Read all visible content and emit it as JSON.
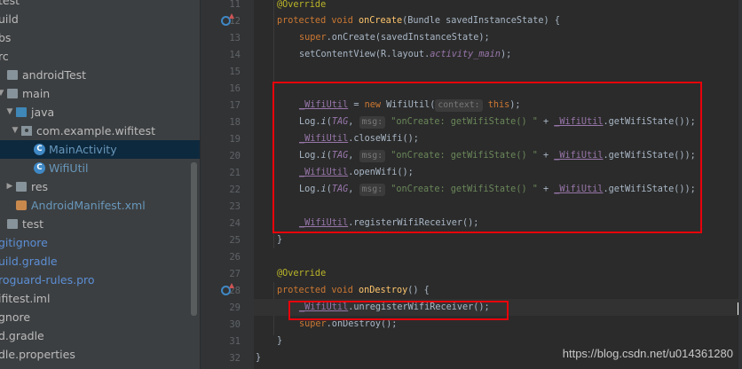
{
  "tree": {
    "items": [
      {
        "label": "test",
        "indent": 0,
        "icon": "none"
      },
      {
        "label": "uild",
        "indent": 0,
        "icon": "none"
      },
      {
        "label": "bs",
        "indent": 0,
        "icon": "none"
      },
      {
        "label": "rc",
        "indent": 0,
        "icon": "none"
      },
      {
        "label": "androidTest",
        "indent": 0,
        "icon": "folder"
      },
      {
        "label": "main",
        "indent": 0,
        "icon": "folder"
      },
      {
        "label": "java",
        "indent": 1,
        "icon": "folder-blue"
      },
      {
        "label": "com.example.wifitest",
        "indent": 2,
        "icon": "package"
      },
      {
        "label": "MainActivity",
        "indent": 3,
        "icon": "class"
      },
      {
        "label": "WifiUtil",
        "indent": 3,
        "icon": "class"
      },
      {
        "label": "res",
        "indent": 1,
        "icon": "folder-res"
      },
      {
        "label": "AndroidManifest.xml",
        "indent": 1,
        "icon": "xml"
      },
      {
        "label": "test",
        "indent": 0,
        "icon": "folder"
      },
      {
        "label": "gitignore",
        "indent": 0,
        "icon": "none"
      },
      {
        "label": "uild.gradle",
        "indent": 0,
        "icon": "none"
      },
      {
        "label": "roguard-rules.pro",
        "indent": 0,
        "icon": "none"
      },
      {
        "label": "ifitest.iml",
        "indent": 0,
        "icon": "none"
      },
      {
        "label": "gnore",
        "indent": 0,
        "icon": "none"
      },
      {
        "label": "d.gradle",
        "indent": 0,
        "icon": "none"
      },
      {
        "label": "dle.properties",
        "indent": 0,
        "icon": "none"
      }
    ]
  },
  "gutter": {
    "line_numbers": [
      "11",
      "12",
      "13",
      "14",
      "15",
      "16",
      "17",
      "18",
      "19",
      "20",
      "21",
      "22",
      "23",
      "24",
      "25",
      "26",
      "27",
      "28",
      "29",
      "30",
      "31",
      "32"
    ]
  },
  "code": {
    "l11": {
      "ann": "@Override"
    },
    "l12": {
      "kw": "protected void ",
      "mth": "onCreate",
      "rest": "(Bundle savedInstanceState) {"
    },
    "l13": {
      "kw": "super",
      "rest": ".onCreate(savedInstanceState);"
    },
    "l14": {
      "pre": "setContentView(R.layout.",
      "cnst": "activity_main",
      "post": ");"
    },
    "l17": {
      "fld": "_WifiUtil",
      "eq": " = ",
      "kw": "new ",
      "cls": "WifiUtil(",
      "hint": "context:",
      "this": "this",
      "post": ");"
    },
    "l18": {
      "pre": "Log.",
      "i": "i",
      "open": "(",
      "tag": "TAG",
      "comma": ", ",
      "hint": "msg:",
      "str": "\"onCreate: getWifiState() \"",
      "plus": " + ",
      "fld": "_WifiUtil",
      "post": ".getWifiState());"
    },
    "l19": {
      "fld": "_WifiUtil",
      "post": ".closeWifi();"
    },
    "l20": {
      "pre": "Log.",
      "i": "i",
      "open": "(",
      "tag": "TAG",
      "comma": ", ",
      "hint": "msg:",
      "str": "\"onCreate: getWifiState() \"",
      "plus": " + ",
      "fld": "_WifiUtil",
      "post": ".getWifiState());"
    },
    "l21": {
      "fld": "_WifiUtil",
      "post": ".openWifi();"
    },
    "l22": {
      "pre": "Log.",
      "i": "i",
      "open": "(",
      "tag": "TAG",
      "comma": ", ",
      "hint": "msg:",
      "str": "\"onCreate: getWifiState() \"",
      "plus": " + ",
      "fld": "_WifiUtil",
      "post": ".getWifiState());"
    },
    "l24": {
      "fld": "_WifiUtil",
      "post": ".registerWifiReceiver();"
    },
    "l25": {
      "brace": "}"
    },
    "l27": {
      "ann": "@Override"
    },
    "l28": {
      "kw": "protected void ",
      "mth": "onDestroy",
      "rest": "() {"
    },
    "l29": {
      "fld": "_WifiUtil",
      "post": ".unregisterWifiReceiver();"
    },
    "l30": {
      "kw": "super",
      "rest": ".onDestroy();"
    },
    "l31": {
      "brace": "}"
    },
    "l32": {
      "brace": "}"
    }
  },
  "watermark": "https://blog.csdn.net/u014361280",
  "colors": {
    "keyword": "#cc7832",
    "annotation": "#bbb529",
    "field": "#9876aa",
    "string": "#6a8759",
    "method": "#ffc66d",
    "highlight_box": "#e8000b"
  }
}
